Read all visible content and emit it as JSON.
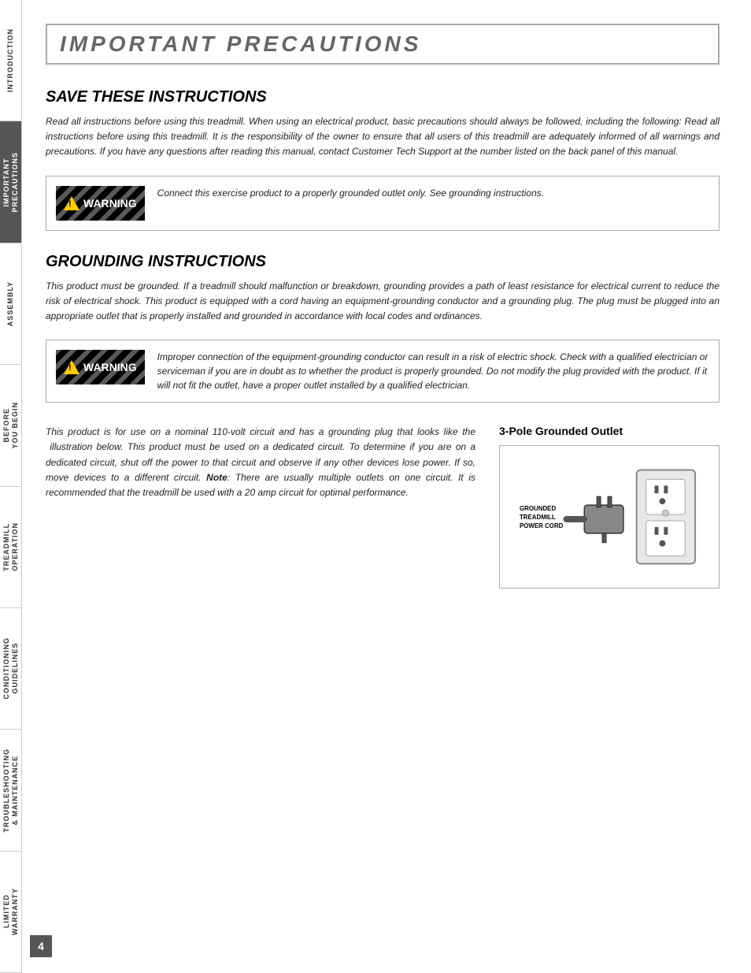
{
  "sidebar": {
    "sections": [
      {
        "label": "INTRODUCTION",
        "active": false
      },
      {
        "label": "IMPORTANT\nPRECAUTIONS",
        "active": true
      },
      {
        "label": "ASSEMBLY",
        "active": false
      },
      {
        "label": "BEFORE\nYOU BEGIN",
        "active": false
      },
      {
        "label": "TREADMILL\nOPERATION",
        "active": false
      },
      {
        "label": "CONDITIONING\nGUIDELINES",
        "active": false
      },
      {
        "label": "TROUBLESHOOTING\n& MAINTENANCE",
        "active": false
      },
      {
        "label": "LIMITED\nWARRANTY",
        "active": false
      }
    ]
  },
  "page": {
    "title": "IMPORTANT PRECAUTIONS",
    "page_number": "4",
    "sections": {
      "save_instructions": {
        "heading": "SAVE THESE INSTRUCTIONS",
        "body": "Read all instructions before using this treadmill. When using an electrical product, basic precautions should always be followed, including the following: Read all instructions before using this treadmill. It is the responsibility of the owner to ensure that all users of this treadmill are adequately informed of all warnings and precautions. If you have any questions after reading this manual, contact Customer Tech Support at the number listed on the back panel of this manual."
      },
      "warning1": {
        "text": "Connect this exercise product to a properly grounded outlet only. See grounding instructions."
      },
      "grounding_instructions": {
        "heading": "GROUNDING INSTRUCTIONS",
        "body": "This product must be grounded. If a treadmill should malfunction or breakdown, grounding provides a path of least resistance for electrical current to reduce the risk of electrical shock. This product is equipped with a cord having an equipment-grounding conductor and a grounding plug. The plug must be plugged into an appropriate outlet that is properly installed and grounded in accordance with local codes and ordinances."
      },
      "warning2": {
        "text": "Improper connection of the equipment-grounding conductor can result in a risk of electric shock. Check with a qualified electrician or serviceman if you are in doubt as to whether the product is properly grounded. Do not modify the plug provided with the product. If it will not fit the outlet, have a proper outlet installed by a qualified electrician."
      },
      "lower_body": "This product is for use on a nominal 110-volt circuit and has a grounding plug that looks like the  illustration below. This product must be used on a dedicated circuit. To determine if you are on a dedicated circuit, shut off the power to that circuit and observe if any other devices lose power. If so, move devices to a different circuit. Note: There are usually multiple outlets on one circuit. It is recommended that the treadmill be used with a 20 amp circuit for optimal performance.",
      "outlet_diagram": {
        "title": "3-Pole Grounded Outlet",
        "cord_label": "GROUNDED\nTREADMILL\nPOWER CORD"
      }
    }
  }
}
